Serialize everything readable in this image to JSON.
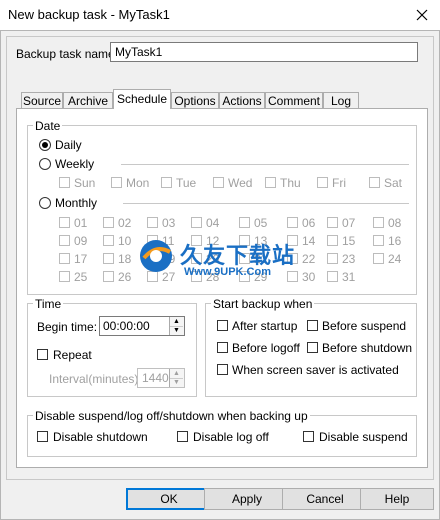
{
  "window": {
    "title": "New backup task - MyTask1"
  },
  "task_name": {
    "label": "Backup task name:",
    "value": "MyTask1"
  },
  "tabs": [
    {
      "label": "Source"
    },
    {
      "label": "Archive"
    },
    {
      "label": "Schedule"
    },
    {
      "label": "Options"
    },
    {
      "label": "Actions"
    },
    {
      "label": "Comment"
    },
    {
      "label": "Log"
    }
  ],
  "date": {
    "title": "Date",
    "daily": "Daily",
    "weekly": "Weekly",
    "monthly": "Monthly",
    "selected": "Daily",
    "weekdays": [
      "Sun",
      "Mon",
      "Tue",
      "Wed",
      "Thu",
      "Fri",
      "Sat"
    ],
    "days": [
      "01",
      "02",
      "03",
      "04",
      "05",
      "06",
      "07",
      "08",
      "09",
      "10",
      "11",
      "12",
      "13",
      "14",
      "15",
      "16",
      "17",
      "18",
      "19",
      "20",
      "21",
      "22",
      "23",
      "24",
      "25",
      "26",
      "27",
      "28",
      "29",
      "30",
      "31"
    ]
  },
  "time": {
    "title": "Time",
    "begin_label": "Begin time:",
    "begin_value": "00:00:00",
    "repeat": "Repeat",
    "interval_label": "Interval(minutes):",
    "interval_value": "1440"
  },
  "start_when": {
    "title": "Start backup when",
    "after_startup": "After startup",
    "before_suspend": "Before suspend",
    "before_logoff": "Before logoff",
    "before_shutdown": "Before shutdown",
    "screensaver": "When screen saver is activated"
  },
  "disable": {
    "title": "Disable suspend/log off/shutdown when backing up",
    "shutdown": "Disable shutdown",
    "logoff": "Disable log off",
    "suspend": "Disable suspend"
  },
  "buttons": {
    "ok": "OK",
    "apply": "Apply",
    "cancel": "Cancel",
    "help": "Help"
  },
  "watermark": {
    "brand": "久友下载站",
    "url": "Www.9UPK.Com"
  },
  "colors": {
    "accent": "#0078d7",
    "watermark_blue": "#1a6fc4",
    "watermark_orange": "#f39a1e"
  }
}
